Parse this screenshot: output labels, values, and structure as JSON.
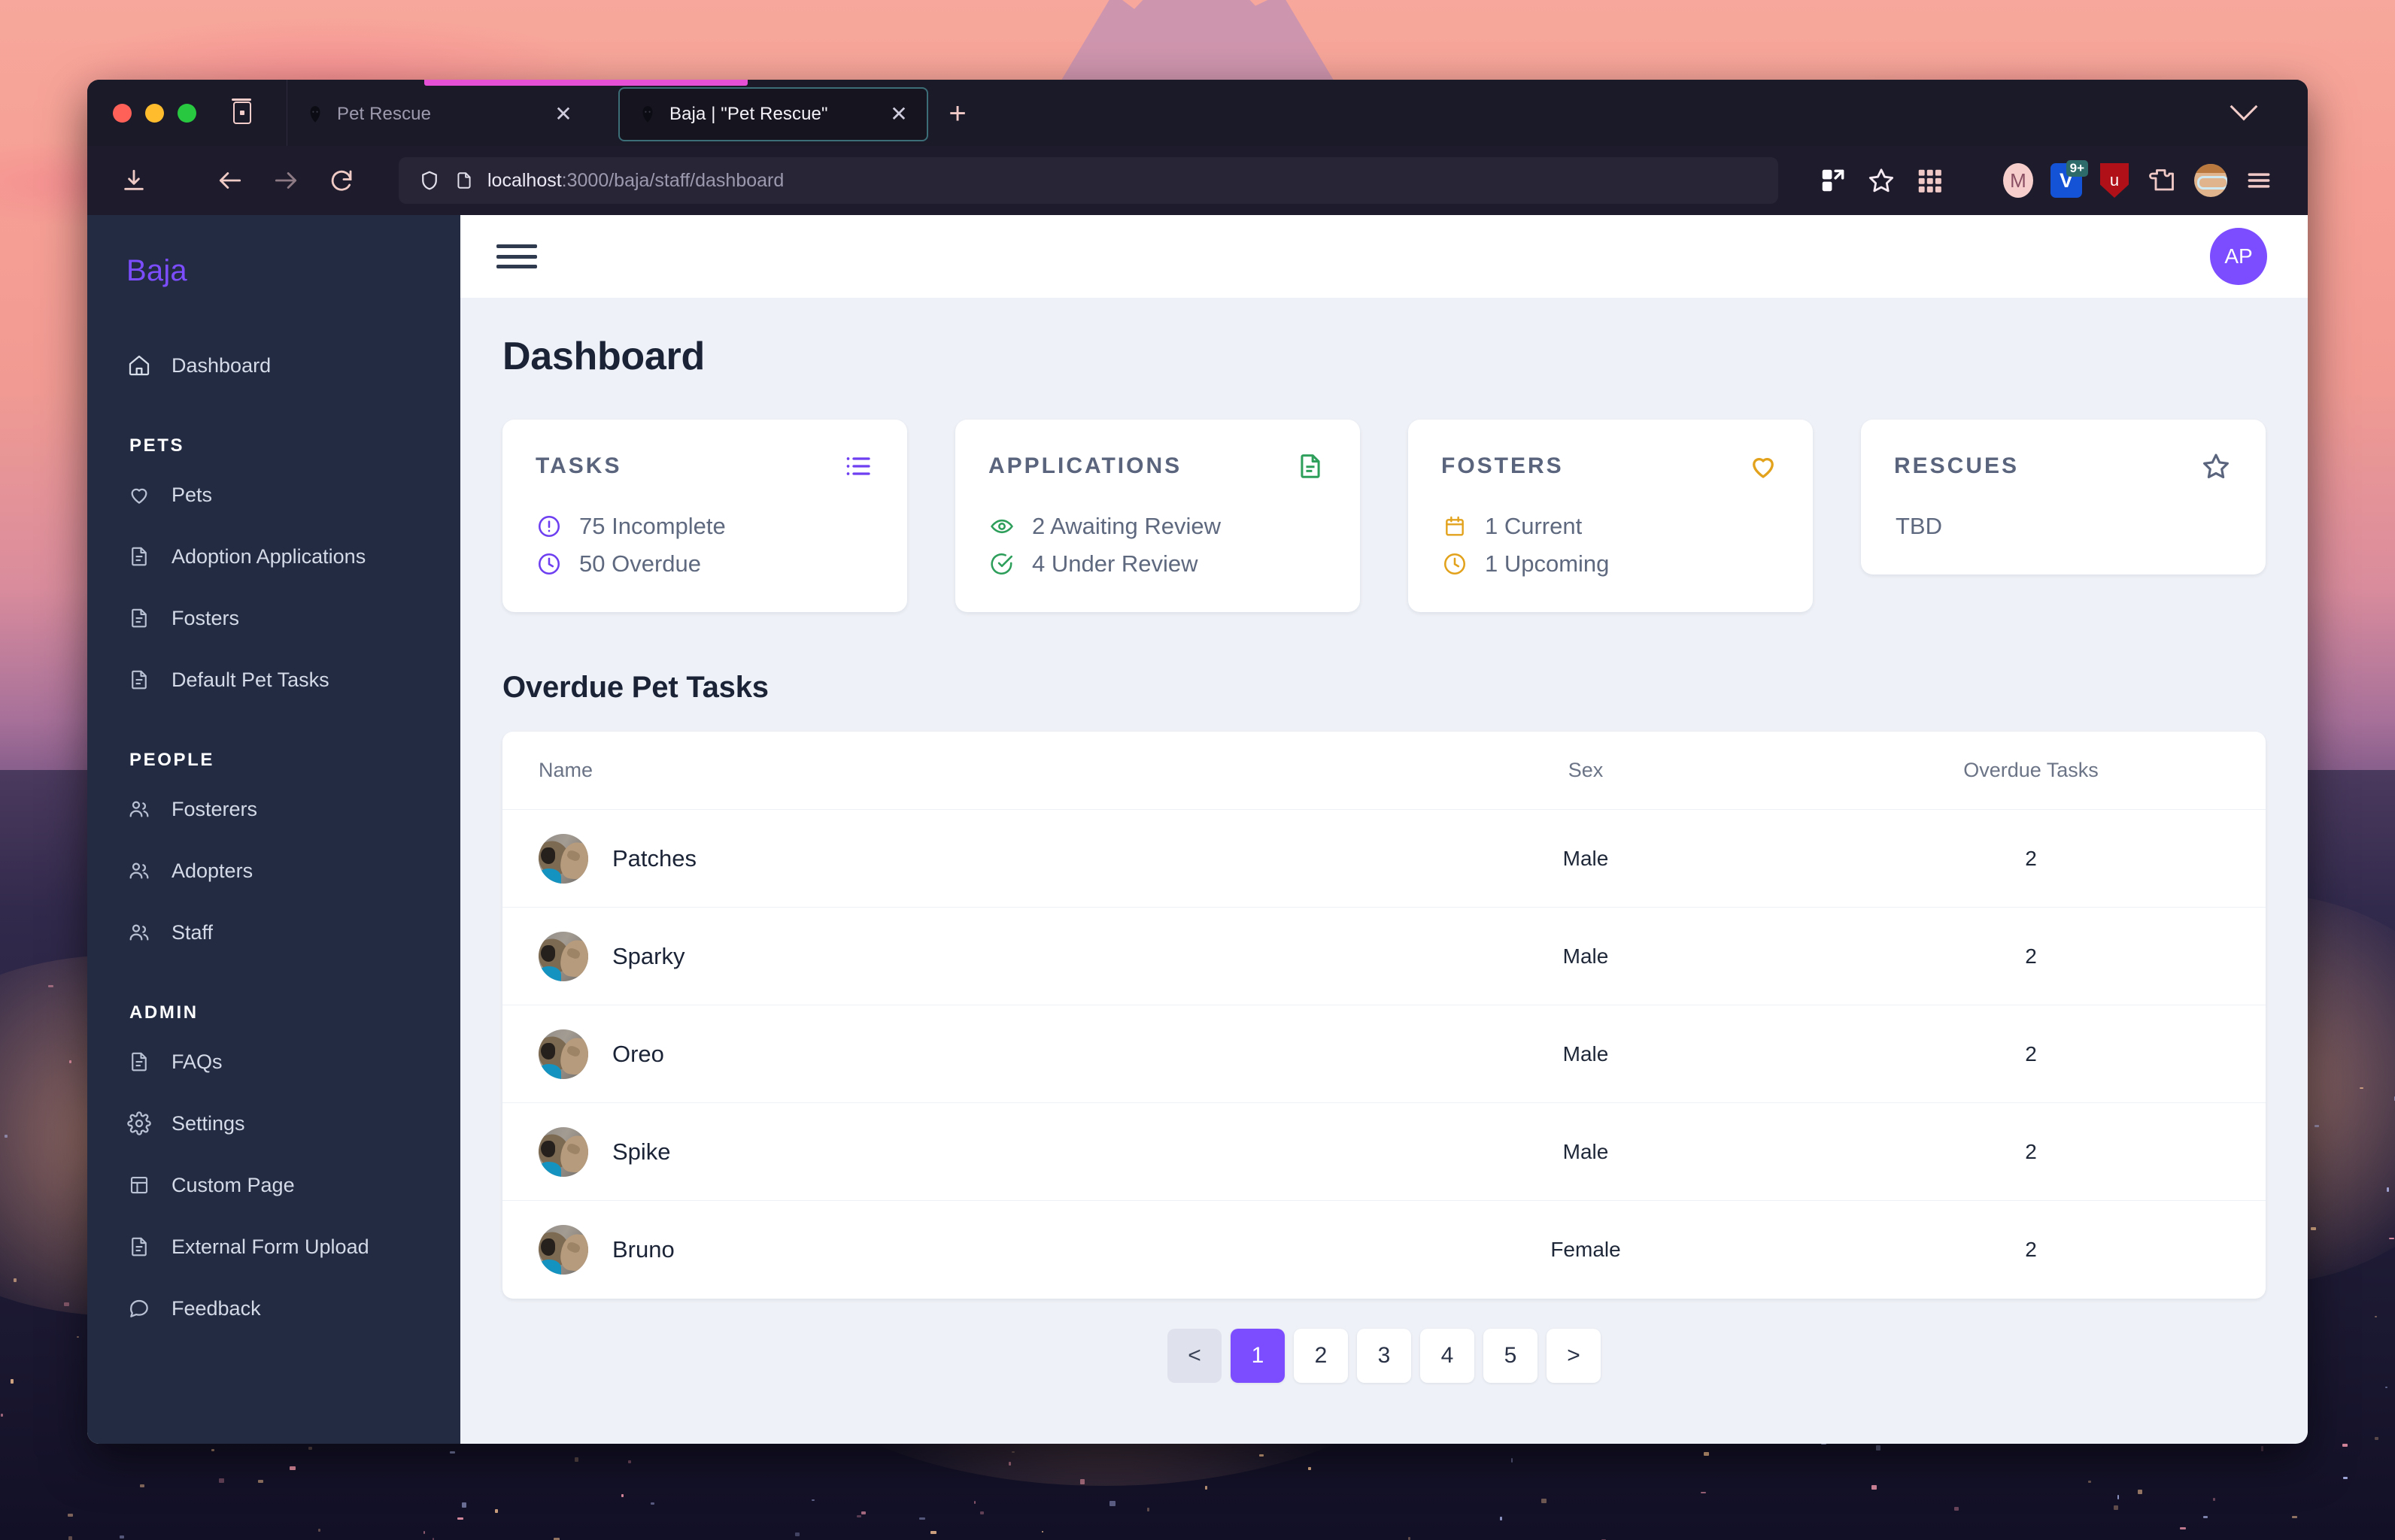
{
  "browser": {
    "tabs": [
      {
        "title": "Pet Rescue",
        "active": false,
        "close_label": "✕"
      },
      {
        "title": "Baja | \"Pet Rescue\"",
        "active": true,
        "close_label": "✕"
      }
    ],
    "new_tab_label": "+",
    "url_host": "localhost",
    "url_path": ":3000/baja/staff/dashboard",
    "extensions": [
      {
        "name": "m-extension",
        "label": "M"
      },
      {
        "name": "v-extension",
        "label": "V",
        "badge": "9+"
      },
      {
        "name": "ublock-origin-extension",
        "label": "u"
      }
    ]
  },
  "sidebar": {
    "brand": "Baja",
    "top_item": {
      "label": "Dashboard",
      "icon": "home-icon"
    },
    "groups": [
      {
        "label": "PETS",
        "items": [
          {
            "label": "Pets",
            "icon": "heart-icon"
          },
          {
            "label": "Adoption Applications",
            "icon": "document-icon"
          },
          {
            "label": "Fosters",
            "icon": "document-icon"
          },
          {
            "label": "Default Pet Tasks",
            "icon": "document-icon"
          }
        ]
      },
      {
        "label": "PEOPLE",
        "items": [
          {
            "label": "Fosterers",
            "icon": "users-icon"
          },
          {
            "label": "Adopters",
            "icon": "users-icon"
          },
          {
            "label": "Staff",
            "icon": "users-icon"
          }
        ]
      },
      {
        "label": "ADMIN",
        "items": [
          {
            "label": "FAQs",
            "icon": "document-icon"
          },
          {
            "label": "Settings",
            "icon": "gear-icon"
          },
          {
            "label": "Custom Page",
            "icon": "layout-icon"
          },
          {
            "label": "External Form Upload",
            "icon": "document-icon"
          },
          {
            "label": "Feedback",
            "icon": "chat-icon"
          }
        ]
      }
    ]
  },
  "header": {
    "menu_icon": "hamburger-icon",
    "avatar_initials": "AP"
  },
  "main": {
    "page_title": "Dashboard",
    "cards": [
      {
        "title": "TASKS",
        "icon": "list-icon",
        "accent": "#6d3ff0",
        "stats": [
          {
            "icon": "alert-circle-icon",
            "text": "75 Incomplete"
          },
          {
            "icon": "clock-icon",
            "text": "50 Overdue"
          }
        ]
      },
      {
        "title": "APPLICATIONS",
        "icon": "file-text-icon",
        "accent": "#2e9e5b",
        "stats": [
          {
            "icon": "eye-icon",
            "text": "2 Awaiting Review"
          },
          {
            "icon": "check-circle-icon",
            "text": "4 Under Review"
          }
        ]
      },
      {
        "title": "FOSTERS",
        "icon": "heart-icon",
        "accent": "#e2a21c",
        "stats": [
          {
            "icon": "calendar-icon",
            "text": "1 Current"
          },
          {
            "icon": "clock-icon",
            "text": "1 Upcoming"
          }
        ]
      },
      {
        "title": "RESCUES",
        "icon": "star-icon",
        "accent": "#5a657d",
        "stats": [],
        "placeholder": "TBD"
      }
    ],
    "table": {
      "section_title": "Overdue Pet Tasks",
      "columns": [
        "Name",
        "Sex",
        "Overdue Tasks"
      ],
      "rows": [
        {
          "name": "Patches",
          "sex": "Male",
          "overdue": "2"
        },
        {
          "name": "Sparky",
          "sex": "Male",
          "overdue": "2"
        },
        {
          "name": "Oreo",
          "sex": "Male",
          "overdue": "2"
        },
        {
          "name": "Spike",
          "sex": "Male",
          "overdue": "2"
        },
        {
          "name": "Bruno",
          "sex": "Female",
          "overdue": "2"
        }
      ]
    },
    "pagination": {
      "prev_label": "<",
      "next_label": ">",
      "pages": [
        "1",
        "2",
        "3",
        "4",
        "5"
      ],
      "current": "1"
    }
  },
  "colors": {
    "accent_purple": "#7c4dff",
    "sidebar_bg": "#222b42",
    "content_bg": "#eef1f7"
  }
}
